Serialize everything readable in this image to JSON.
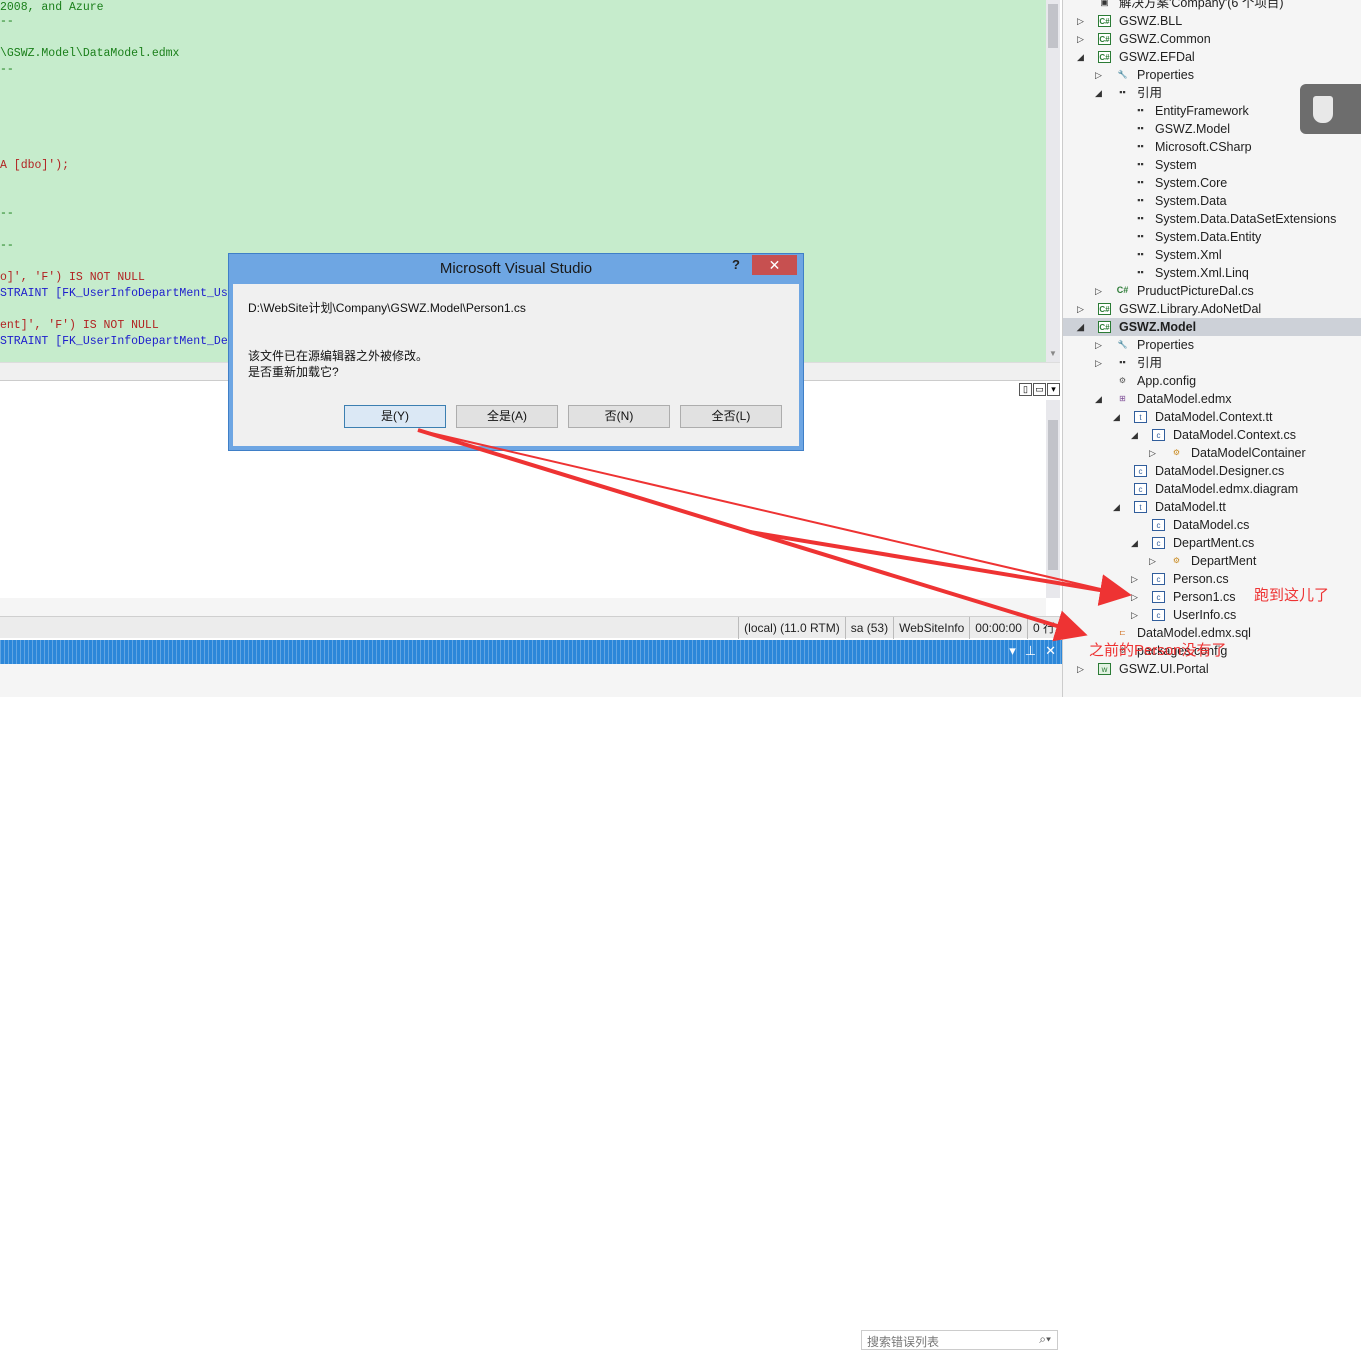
{
  "editor": {
    "lines": [
      {
        "text": "2008, and Azure",
        "cls": "c-green"
      },
      {
        "text": "--",
        "cls": "c-green"
      },
      {
        "text": "\\GSWZ.Model\\DataModel.edmx",
        "cls": "c-green"
      },
      {
        "text": "--",
        "cls": "c-green"
      },
      {
        "text": "A [dbo]');",
        "cls": "c-red"
      },
      {
        "text": "--",
        "cls": "c-green"
      },
      {
        "text": "--",
        "cls": "c-green"
      },
      {
        "text": "o]', 'F') IS NOT NULL",
        "cls": "c-red"
      },
      {
        "text": "STRAINT [FK_UserInfoDepartMent_Us",
        "cls": "c-blue"
      },
      {
        "text": "ent]', 'F') IS NOT NULL",
        "cls": "c-red"
      },
      {
        "text": "STRAINT [FK_UserInfoDepartMent_De",
        "cls": "c-blue"
      }
    ]
  },
  "statusbar": {
    "server": "(local) (11.0 RTM)",
    "user": "sa (53)",
    "database": "WebSiteInfo",
    "time": "00:00:00",
    "rows": "0 行"
  },
  "error_list": {
    "search_placeholder": "搜索错误列表"
  },
  "dialog": {
    "title": "Microsoft Visual Studio",
    "help": "?",
    "close": "✕",
    "path": "D:\\WebSite计划\\Company\\GSWZ.Model\\Person1.cs",
    "message_line1": "该文件已在源编辑器之外被修改。",
    "message_line2": "是否重新加载它?",
    "buttons": {
      "yes": "是(Y)",
      "yes_all": "全是(A)",
      "no": "否(N)",
      "no_all": "全否(L)"
    }
  },
  "solution_explorer": {
    "items": [
      {
        "label": "解决方案'Company'(6 个项目)",
        "level": 0,
        "twisty": "",
        "icon": "solution-icon"
      },
      {
        "label": "GSWZ.BLL",
        "level": 0,
        "twisty": "▷",
        "icon": "csharp-project-icon"
      },
      {
        "label": "GSWZ.Common",
        "level": 0,
        "twisty": "▷",
        "icon": "csharp-project-icon"
      },
      {
        "label": "GSWZ.EFDal",
        "level": 0,
        "twisty": "◢",
        "icon": "csharp-project-icon"
      },
      {
        "label": "Properties",
        "level": 1,
        "twisty": "▷",
        "icon": "wrench-icon"
      },
      {
        "label": "引用",
        "level": 1,
        "twisty": "◢",
        "icon": "references-icon"
      },
      {
        "label": "EntityFramework",
        "level": 2,
        "twisty": "",
        "icon": "reference-icon"
      },
      {
        "label": "GSWZ.Model",
        "level": 2,
        "twisty": "",
        "icon": "reference-icon"
      },
      {
        "label": "Microsoft.CSharp",
        "level": 2,
        "twisty": "",
        "icon": "reference-icon"
      },
      {
        "label": "System",
        "level": 2,
        "twisty": "",
        "icon": "reference-icon"
      },
      {
        "label": "System.Core",
        "level": 2,
        "twisty": "",
        "icon": "reference-icon"
      },
      {
        "label": "System.Data",
        "level": 2,
        "twisty": "",
        "icon": "reference-icon"
      },
      {
        "label": "System.Data.DataSetExtensions",
        "level": 2,
        "twisty": "",
        "icon": "reference-icon"
      },
      {
        "label": "System.Data.Entity",
        "level": 2,
        "twisty": "",
        "icon": "reference-icon"
      },
      {
        "label": "System.Xml",
        "level": 2,
        "twisty": "",
        "icon": "reference-icon"
      },
      {
        "label": "System.Xml.Linq",
        "level": 2,
        "twisty": "",
        "icon": "reference-icon"
      },
      {
        "label": "PruductPictureDal.cs",
        "level": 1,
        "twisty": "▷",
        "icon": "csharp-file-icon"
      },
      {
        "label": "GSWZ.Library.AdoNetDal",
        "level": 0,
        "twisty": "▷",
        "icon": "csharp-project-icon"
      },
      {
        "label": "GSWZ.Model",
        "level": 0,
        "twisty": "◢",
        "icon": "csharp-project-icon",
        "selected": true
      },
      {
        "label": "Properties",
        "level": 1,
        "twisty": "▷",
        "icon": "wrench-icon"
      },
      {
        "label": "引用",
        "level": 1,
        "twisty": "▷",
        "icon": "references-icon"
      },
      {
        "label": "App.config",
        "level": 1,
        "twisty": "",
        "icon": "config-icon"
      },
      {
        "label": "DataModel.edmx",
        "level": 1,
        "twisty": "◢",
        "icon": "edmx-icon"
      },
      {
        "label": "DataModel.Context.tt",
        "level": 2,
        "twisty": "◢",
        "icon": "tt-file-icon"
      },
      {
        "label": "DataModel.Context.cs",
        "level": 3,
        "twisty": "◢",
        "icon": "cs-file-icon"
      },
      {
        "label": "DataModelContainer",
        "level": 4,
        "twisty": "▷",
        "icon": "class-icon"
      },
      {
        "label": "DataModel.Designer.cs",
        "level": 2,
        "twisty": "",
        "icon": "cs-file-icon"
      },
      {
        "label": "DataModel.edmx.diagram",
        "level": 2,
        "twisty": "",
        "icon": "cs-file-icon"
      },
      {
        "label": "DataModel.tt",
        "level": 2,
        "twisty": "◢",
        "icon": "tt-file-icon"
      },
      {
        "label": "DataModel.cs",
        "level": 3,
        "twisty": "",
        "icon": "cs-file-icon"
      },
      {
        "label": "DepartMent.cs",
        "level": 3,
        "twisty": "◢",
        "icon": "cs-file-icon"
      },
      {
        "label": "DepartMent",
        "level": 4,
        "twisty": "▷",
        "icon": "class-icon"
      },
      {
        "label": "Person.cs",
        "level": 3,
        "twisty": "▷",
        "icon": "cs-file-icon"
      },
      {
        "label": "Person1.cs",
        "level": 3,
        "twisty": "▷",
        "icon": "cs-file-icon"
      },
      {
        "label": "UserInfo.cs",
        "level": 3,
        "twisty": "▷",
        "icon": "cs-file-icon"
      },
      {
        "label": "DataModel.edmx.sql",
        "level": 1,
        "twisty": "",
        "icon": "sql-file-icon"
      },
      {
        "label": "packages.config",
        "level": 1,
        "twisty": "",
        "icon": "config-icon"
      },
      {
        "label": "GSWZ.UI.Portal",
        "level": 0,
        "twisty": "▷",
        "icon": "web-project-icon"
      }
    ]
  },
  "annotations": {
    "moved_here": "跑到这儿了",
    "person_gone": "之前的Person没有了"
  },
  "colors": {
    "editor_bg": "#c6eccc",
    "dialog_title_bg": "#6ea6e3",
    "close_button": "#c75050",
    "annotation": "#ee3333"
  }
}
